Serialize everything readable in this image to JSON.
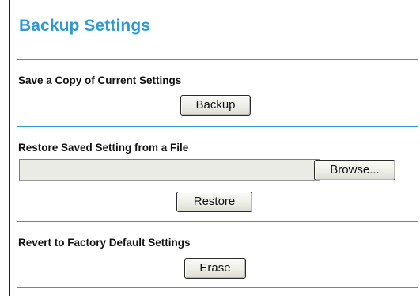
{
  "header": {
    "title": "Backup Settings"
  },
  "backup_section": {
    "label": "Save a Copy of Current Settings",
    "button_label": "Backup"
  },
  "restore_section": {
    "label": "Restore Saved Setting from a File",
    "file_value": "",
    "browse_label": "Browse...",
    "button_label": "Restore"
  },
  "erase_section": {
    "label": "Revert to Factory Default Settings",
    "button_label": "Erase"
  },
  "colors": {
    "accent": "#2e9ad3",
    "frame_border": "#1f1f1f",
    "input_background": "#ebebe6"
  }
}
